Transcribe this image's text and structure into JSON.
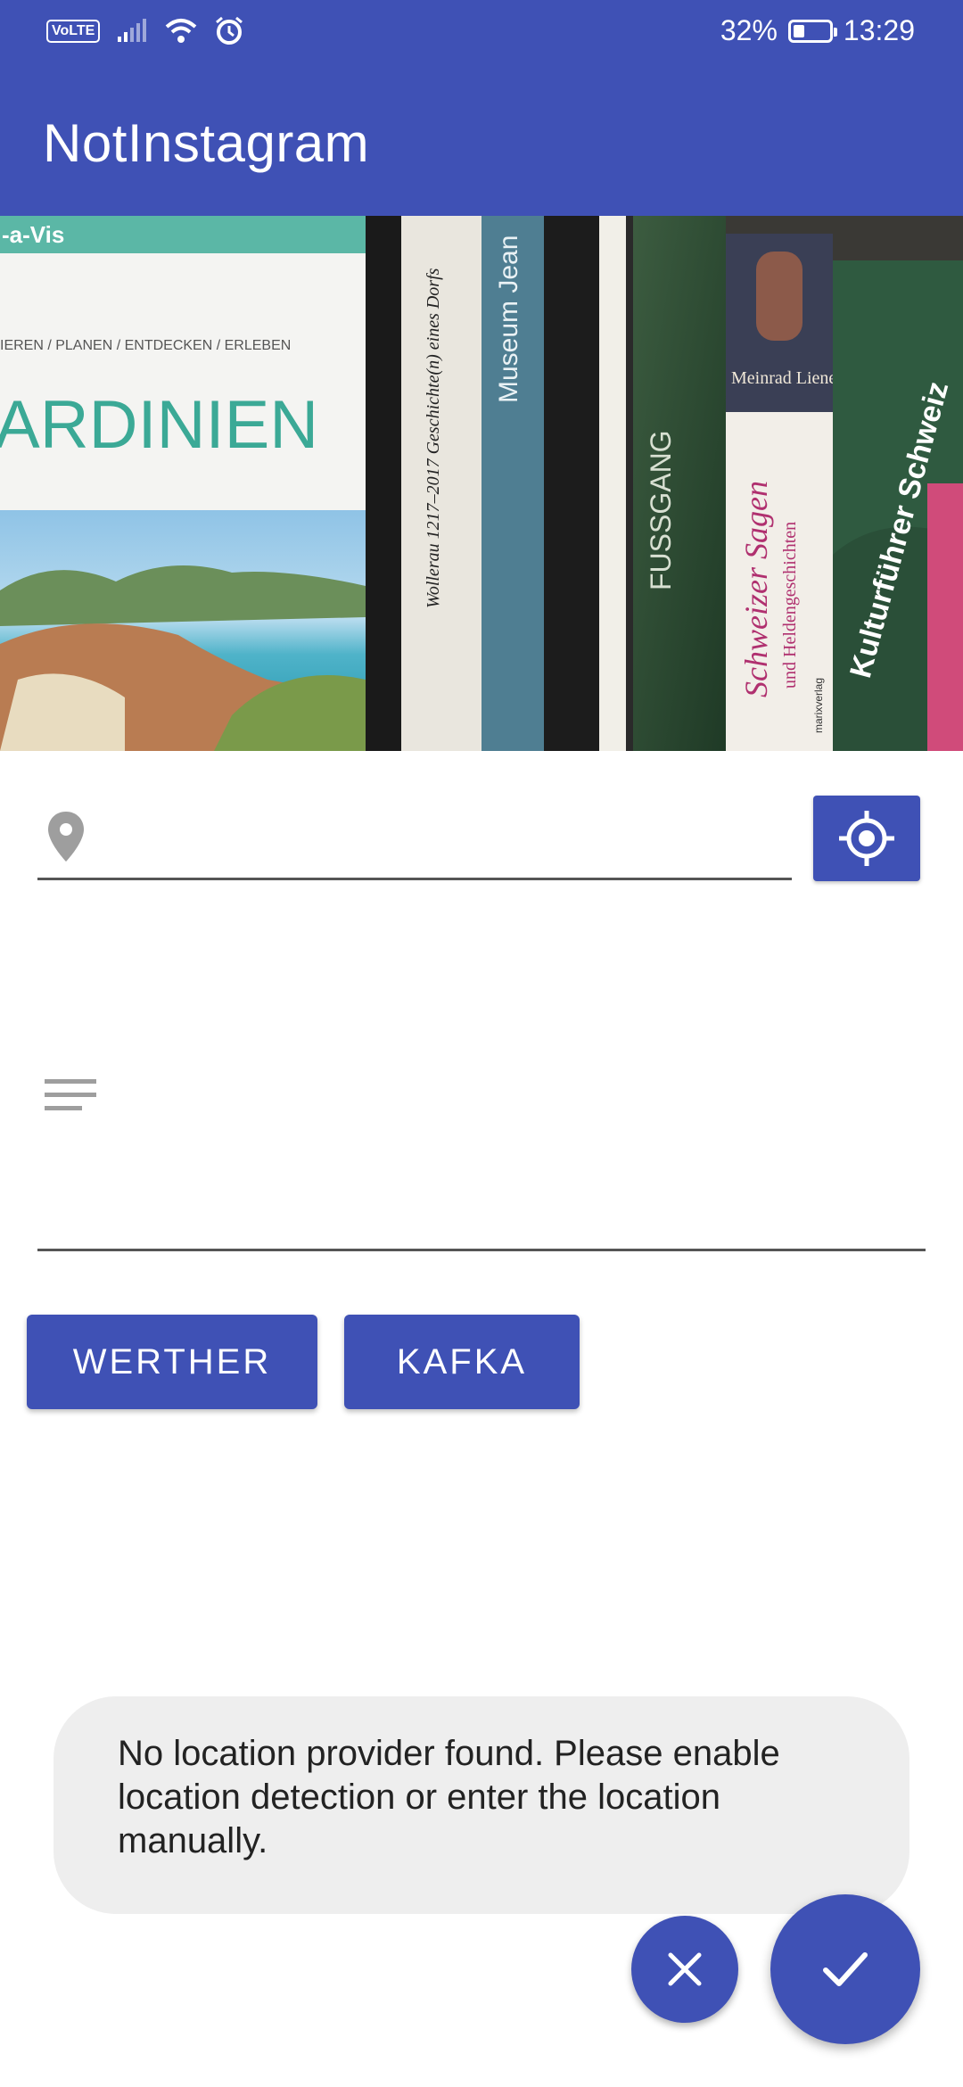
{
  "status_bar": {
    "network_badge": "VoLTE",
    "battery_percent": "32%",
    "battery_level": 0.32,
    "time": "13:29",
    "icons": [
      "signal-icon",
      "wifi-icon",
      "alarm-icon",
      "battery-icon"
    ]
  },
  "app_bar": {
    "title": "NotInstagram"
  },
  "photo": {
    "description_icon": "bookshelf-photo",
    "cover_texts": {
      "sardinien": "ARDINIEN",
      "sardinien_sub": "IEREN / PLANEN / ENTDECKEN / ERLEBEN",
      "vis": "-a-Vis",
      "wollerau": "Wollerau 1217–2017  Geschichte(n) eines Dorfs",
      "museum": "Museum Jean",
      "fussgang": "FUSSGANG",
      "sagen": "Schweizer Sagen",
      "sagen_sub": "und Heldengeschichten",
      "author": "Meinrad Lienert",
      "kultur": "Kulturführer Schweiz",
      "marix": "marixverlag"
    }
  },
  "location_field": {
    "value": "",
    "placeholder": "",
    "icon": "location-pin-icon"
  },
  "gps_button": {
    "icon": "my-location-icon"
  },
  "description_field": {
    "value": "",
    "placeholder": "",
    "icon": "notes-icon"
  },
  "tag_buttons": [
    "WERTHER",
    "KAFKA"
  ],
  "toast": {
    "message": "No location provider found. Please enable location detection or enter the location manually."
  },
  "fabs": {
    "cancel_icon": "close-icon",
    "confirm_icon": "check-icon"
  },
  "colors": {
    "primary": "#3f51b5",
    "toast_bg": "#eeeeee",
    "icon_gray": "#9e9e9e"
  }
}
